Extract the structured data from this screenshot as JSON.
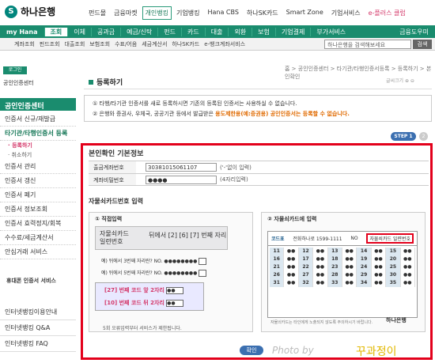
{
  "brand": {
    "name": "하나은행",
    "mark": "S"
  },
  "topnav": [
    "펀드몰",
    "금융마켓",
    "개인뱅킹",
    "기업뱅킹",
    "Hana CBS",
    "하나SK카드",
    "Smart Zone",
    "기업서비스",
    "e-플러스 클럽"
  ],
  "topnav_active": "개인뱅킹",
  "mainbar": {
    "myhana": "my Hana",
    "items": [
      "조회",
      "이체",
      "공과금",
      "예금/신탁",
      "펀드",
      "카드",
      "대출",
      "외환",
      "보험",
      "기업결제",
      "부가서비스"
    ],
    "selected": "조회",
    "fin": "금융도우미"
  },
  "subbar": [
    "계좌조회",
    "펀드조회",
    "대출조회",
    "보험조회",
    "수표/어음",
    "세금계산서",
    "하나SK카드",
    "e-뱅크계좌서비스"
  ],
  "search": {
    "placeholder": "하나은행을 검색해보세요",
    "button": "검색"
  },
  "side": {
    "login": "로그인",
    "certcenter_link": "공인인증센터",
    "header": "공인인증센터",
    "menu": [
      {
        "label": "인증서 신규/재발급",
        "type": "item"
      },
      {
        "label": "타기관/타행인증서 등록",
        "type": "item",
        "on": true
      },
      {
        "label": "· 등록하기",
        "type": "sub",
        "on": true
      },
      {
        "label": "· 취소하기",
        "type": "sub"
      },
      {
        "label": "인증서 관리",
        "type": "item"
      },
      {
        "label": "인증서 갱신",
        "type": "item"
      },
      {
        "label": "인증서 폐기",
        "type": "item"
      },
      {
        "label": "인증서 정보조회",
        "type": "item"
      },
      {
        "label": "인증서 효력정지/회복",
        "type": "item"
      },
      {
        "label": "수수료/세금계산서",
        "type": "item"
      },
      {
        "label": "안심거래 서비스",
        "type": "item"
      }
    ],
    "mobile": "휴대폰 인증서 서비스",
    "bottom": [
      "인터넷뱅킹이용안내",
      "인터넷뱅킹 Q&A",
      "인터넷뱅킹 FAQ"
    ]
  },
  "breadcrumb": "홈 > 공인인증센터 > 타기관/타행인증서등록 > 등록하기 > 본인확인",
  "page": {
    "title": "등록하기",
    "utility": "글씨크기 ⊕ ⊖"
  },
  "notice": {
    "line1": "타행/타기관 인증서를 새로 등록하시면 기존의 등록된 인증서는 사용하실 수 없습니다.",
    "line2a": "은행와 증권사, 우체국, 공공기관 등에서 발급받은 ",
    "line2b": "용도제한용(예:증권용) 공인인증서는 등록할 수 없습니다."
  },
  "step": {
    "current": "STEP 1",
    "next": "2"
  },
  "identity": {
    "title": "본인확인 기본정보",
    "rows": [
      {
        "label": "출금계좌번호",
        "value": "30381015061107",
        "hint": "('-'없이 입력)"
      },
      {
        "label": "계좌비밀번호",
        "value": "●●●●",
        "hint": "(4자리입력)"
      }
    ]
  },
  "cardsec": {
    "title": "자물쇠카드번호 입력",
    "direct": "직접입력",
    "card": "자물쇠카드에 입력",
    "cardtxt1": "자물쇠카드",
    "cardtxt2": "일련번호",
    "digits": "뒤에서 [2] [6] [7] 번째 자리",
    "q1": "예) 뒤에서 3번째 자리란? NO. ●●●●●●●●",
    "q2": "예) 뒤에서 5번째 자리란? NO. ●●●●●●●●",
    "code1": "[27] 번째 코드 앞 2자리",
    "code2": "[10] 번째 코드 뒤 2자리",
    "codeval": "●●",
    "foot": "5회 오류입력부터 서비스가 제한됩니다.",
    "gridhead_code": "코드표",
    "gridhead_tel": "전화하나로 1599-1111",
    "gridhead_no": "NO",
    "gridbtn": "자물쇠카드 일련번호",
    "gridfoot": "자물쇠카드는 타인에게 노출되지 않도록 주의하시기 바랍니다.",
    "banklogo": "하나은행"
  },
  "grid_nums": [
    "11",
    "12",
    "13",
    "14",
    "15",
    "16",
    "17",
    "18",
    "19",
    "20",
    "21",
    "22",
    "23",
    "24",
    "25",
    "26",
    "27",
    "28",
    "29",
    "30",
    "31",
    "32",
    "33",
    "34",
    "35"
  ],
  "confirm": "확인",
  "watermark": "Photo by",
  "watermark2": "꾸과정이"
}
